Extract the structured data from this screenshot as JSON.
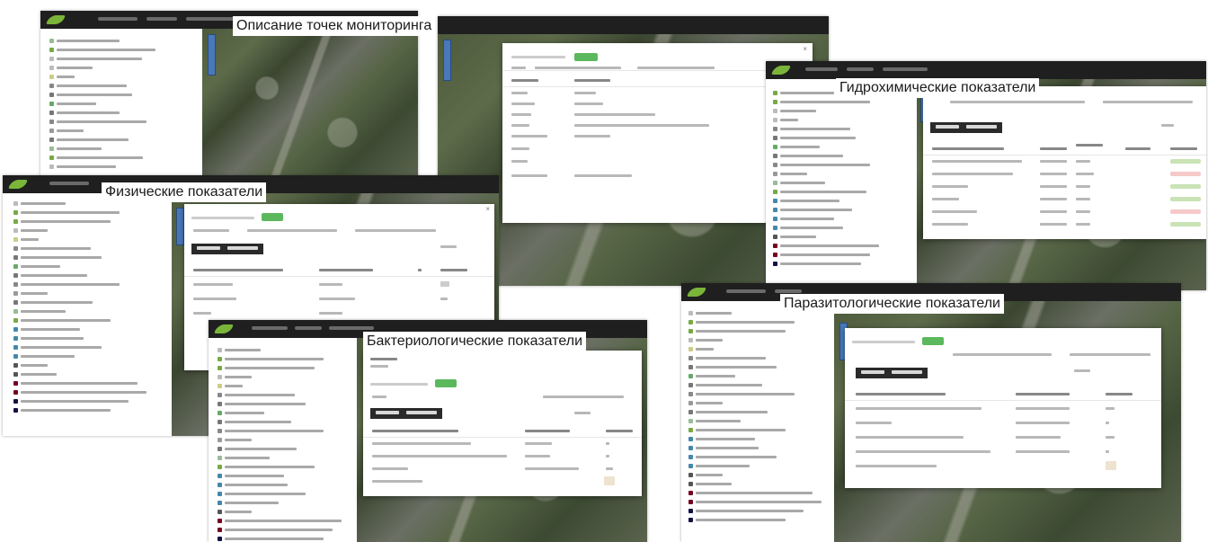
{
  "captions": {
    "monitoring_points": "Описание точек мониторинга",
    "hydrochemical": "Гидрохимические показатели",
    "physical": "Физические показатели",
    "bacteriological": "Бактериологические показатели",
    "parasitological": "Паразитологические показатели"
  },
  "colors": {
    "topbar": "#1f1f1f",
    "brand_green": "#7ab53a",
    "button_green": "#5cb85c",
    "tab_dark": "#2a2a2a",
    "caption_text": "#1a1a1a"
  },
  "icons": [
    "logo-icon",
    "zoom-in-icon",
    "zoom-out-icon",
    "layer-tree-icon",
    "close-icon"
  ]
}
